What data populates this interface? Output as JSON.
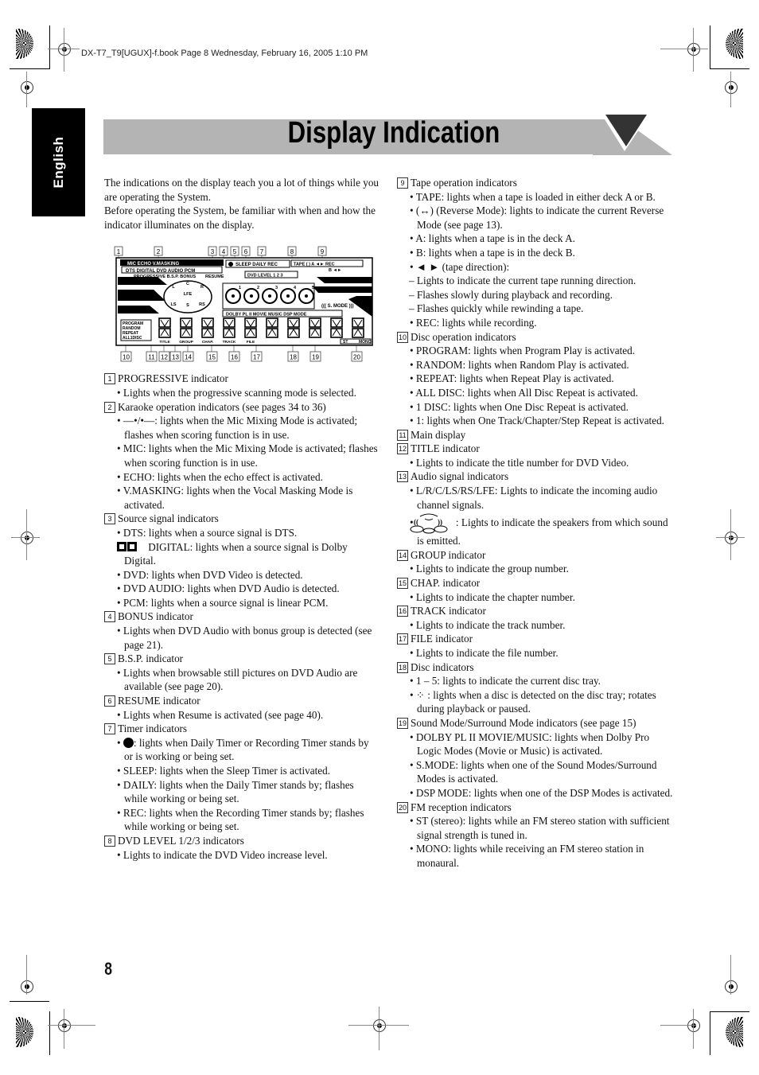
{
  "print_header": "DX-T7_T9[UGUX]-f.book  Page 8  Wednesday, February 16, 2005  1:10 PM",
  "language_tab": "English",
  "page_title": "Display Indication",
  "page_number": "8",
  "intro": [
    "The indications on the display teach you a lot of things while you are operating the System.",
    "Before operating the System, be familiar with when and how the indicator illuminates on the display."
  ],
  "figure": {
    "callouts_top": [
      "1",
      "2",
      "3",
      "4",
      "5",
      "6",
      "7",
      "8",
      "9"
    ],
    "callouts_bottom": [
      "10",
      "11",
      "12",
      "13",
      "14",
      "15",
      "16",
      "17",
      "18",
      "19",
      "20"
    ],
    "labels": {
      "karaoke": "MIC  ECHO  V.MASKING",
      "source": "DTS  DIGITAL DVD AUDIO PCM",
      "progressive": "PROGRESSIVE  B.S.P. BONUS",
      "resume": "RESUME",
      "timer": "SLEEP DAILY REC",
      "dvd_level": "DVD LEVEL 1 2 3",
      "tape": "TAPE ( ) A ◄► REC",
      "tape_b": "B ◄►",
      "channels": [
        "L",
        "C",
        "R",
        "LFE",
        "LS",
        "S",
        "RS"
      ],
      "discs": [
        "1",
        "2",
        "3",
        "4",
        "5"
      ],
      "smode": "((( S. MODE )))",
      "sound_modes": "DOLBY PL II  MOVIE  MUSIC DSP MODE",
      "disc_ops": [
        "PROGRAM",
        "RANDOM",
        "REPEAT",
        "ALL1DISC"
      ],
      "segment_labels": [
        "TITLE",
        "GROUP",
        "CHAP.",
        "TRACK",
        "FILE"
      ],
      "fm": [
        "ST",
        "MONO"
      ]
    }
  },
  "left_column": [
    {
      "type": "head",
      "num": "1",
      "text": "PROGRESSIVE indicator"
    },
    {
      "type": "bullet",
      "text": "Lights when the progressive scanning mode is selected."
    },
    {
      "type": "head",
      "num": "2",
      "text": "Karaoke operation indicators (see pages 34 to 36)"
    },
    {
      "type": "bullet",
      "text": "—•/•—: lights when the Mic Mixing Mode is activated; flashes when scoring function is in use."
    },
    {
      "type": "bullet",
      "text": "MIC: lights when the Mic Mixing Mode is activated; flashes when scoring function is in use."
    },
    {
      "type": "bullet",
      "text": "ECHO: lights when the echo effect is activated."
    },
    {
      "type": "bullet",
      "text": "V.MASKING: lights when the Vocal Masking Mode is activated."
    },
    {
      "type": "head",
      "num": "3",
      "text": "Source signal indicators"
    },
    {
      "type": "bullet",
      "text": "DTS: lights when a source signal is DTS."
    },
    {
      "type": "bullet",
      "icon": "dolby-digital-icon",
      "text": " DIGITAL: lights when a source signal is Dolby Digital."
    },
    {
      "type": "bullet",
      "text": "DVD: lights when DVD Video is detected."
    },
    {
      "type": "bullet",
      "text": "DVD AUDIO: lights when DVD Audio is detected."
    },
    {
      "type": "bullet",
      "text": "PCM: lights when a source signal is linear PCM."
    },
    {
      "type": "head",
      "num": "4",
      "text": "BONUS indicator"
    },
    {
      "type": "bullet",
      "text": "Lights when DVD Audio with bonus group is detected (see page 21)."
    },
    {
      "type": "head",
      "num": "5",
      "text": "B.S.P. indicator"
    },
    {
      "type": "bullet",
      "text": "Lights when browsable still pictures on DVD Audio are available (see page 20)."
    },
    {
      "type": "head",
      "num": "6",
      "text": "RESUME indicator"
    },
    {
      "type": "bullet",
      "text": "Lights when Resume is activated (see page 40)."
    },
    {
      "type": "head",
      "num": "7",
      "text": "Timer indicators"
    },
    {
      "type": "bullet",
      "icon": "clock-icon",
      "text": ": lights when Daily Timer or Recording Timer stands by or is working or being set."
    },
    {
      "type": "bullet",
      "text": "SLEEP: lights when the Sleep Timer is activated."
    },
    {
      "type": "bullet",
      "text": "DAILY: lights when the Daily Timer stands by; flashes while working or being set."
    },
    {
      "type": "bullet",
      "text": "REC: lights when the Recording Timer stands by; flashes while working or being set."
    },
    {
      "type": "head",
      "num": "8",
      "text": "DVD LEVEL 1/2/3 indicators"
    },
    {
      "type": "bullet",
      "text": "Lights to indicate the DVD Video increase level."
    }
  ],
  "right_column": [
    {
      "type": "head",
      "num": "9",
      "text": "Tape operation indicators"
    },
    {
      "type": "bullet",
      "text": "TAPE: lights when a tape is loaded in either deck A or B."
    },
    {
      "type": "bullet",
      "text": "(↔) (Reverse Mode): lights to indicate the current Reverse Mode (see page 13)."
    },
    {
      "type": "bullet",
      "text": "A: lights when a tape is in the deck A."
    },
    {
      "type": "bullet",
      "text": "B: lights when a tape is in the deck B."
    },
    {
      "type": "bullet",
      "text": "◄ ► (tape direction):"
    },
    {
      "type": "dash",
      "text": "– Lights to indicate the current tape running direction."
    },
    {
      "type": "dash",
      "text": "– Flashes slowly during playback and recording."
    },
    {
      "type": "dash",
      "text": "– Flashes quickly while rewinding a tape."
    },
    {
      "type": "bullet",
      "text": "REC: lights while recording."
    },
    {
      "type": "head",
      "num": "10",
      "text": "Disc operation indicators"
    },
    {
      "type": "bullet",
      "text": "PROGRAM: lights when Program Play is activated."
    },
    {
      "type": "bullet",
      "text": "RANDOM: lights when Random Play is activated."
    },
    {
      "type": "bullet",
      "text": "REPEAT: lights when Repeat Play is activated."
    },
    {
      "type": "bullet",
      "text": "ALL DISC: lights when All Disc Repeat is activated."
    },
    {
      "type": "bullet",
      "text": "1 DISC: lights when One Disc Repeat is activated."
    },
    {
      "type": "bullet",
      "text": "1: lights when One Track/Chapter/Step Repeat is activated."
    },
    {
      "type": "head",
      "num": "11",
      "text": "Main display"
    },
    {
      "type": "head",
      "num": "12",
      "text": "TITLE indicator"
    },
    {
      "type": "bullet",
      "text": "Lights to indicate the title number for DVD Video."
    },
    {
      "type": "head",
      "num": "13",
      "text": "Audio signal indicators"
    },
    {
      "type": "bullet",
      "text": "L/R/C/LS/RS/LFE: Lights to indicate the incoming audio channel signals."
    },
    {
      "type": "bullet",
      "icon": "speaker-layout-icon",
      "text": ": Lights to indicate the speakers from which sound is emitted."
    },
    {
      "type": "head",
      "num": "14",
      "text": "GROUP indicator"
    },
    {
      "type": "bullet",
      "text": "Lights to indicate the group number."
    },
    {
      "type": "head",
      "num": "15",
      "text": "CHAP. indicator"
    },
    {
      "type": "bullet",
      "text": "Lights to indicate the chapter number."
    },
    {
      "type": "head",
      "num": "16",
      "text": "TRACK indicator"
    },
    {
      "type": "bullet",
      "text": "Lights to indicate the track number."
    },
    {
      "type": "head",
      "num": "17",
      "text": "FILE indicator"
    },
    {
      "type": "bullet",
      "text": "Lights to indicate the file number."
    },
    {
      "type": "head",
      "num": "18",
      "text": "Disc indicators"
    },
    {
      "type": "bullet",
      "text": "1 – 5: lights to indicate the current disc tray."
    },
    {
      "type": "bullet",
      "text": "⁘ : lights when a disc is detected on the disc tray; rotates during playback or paused."
    },
    {
      "type": "head",
      "num": "19",
      "text": "Sound Mode/Surround Mode indicators (see page 15)"
    },
    {
      "type": "bullet",
      "text": "DOLBY PL II MOVIE/MUSIC: lights when Dolby Pro Logic Modes (Movie or Music) is activated."
    },
    {
      "type": "bullet",
      "text": "S.MODE: lights when one of the Sound Modes/Surround Modes is activated."
    },
    {
      "type": "bullet",
      "text": "DSP MODE: lights when one of the DSP Modes is activated."
    },
    {
      "type": "head",
      "num": "20",
      "text": "FM reception indicators"
    },
    {
      "type": "bullet",
      "text": "ST (stereo): lights while an FM stereo station with sufficient signal strength is tuned in."
    },
    {
      "type": "bullet",
      "text": "MONO: lights while receiving an FM stereo station in monaural."
    }
  ]
}
